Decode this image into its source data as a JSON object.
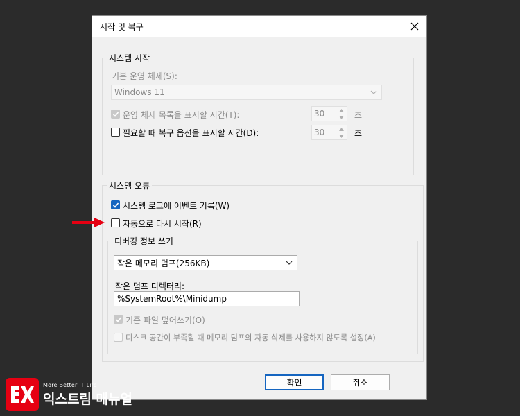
{
  "dialog": {
    "title": "시작 및 복구",
    "close_icon": "close-icon"
  },
  "system_startup": {
    "legend": "시스템 시작",
    "default_os_label": "기본 운영 체제(S):",
    "default_os_value": "Windows 11",
    "os_list_time_label": "운영 체제 목록을 표시할 시간(T):",
    "os_list_time_value": "30",
    "os_list_time_unit": "초",
    "recovery_time_label": "필요할 때 복구 옵션을 표시할 시간(D):",
    "recovery_time_value": "30",
    "recovery_time_unit": "초"
  },
  "system_failure": {
    "legend": "시스템 오류",
    "write_event_label": "시스템 로그에 이벤트 기록(W)",
    "auto_restart_label": "자동으로 다시 시작(R)",
    "debug_info": {
      "legend": "디버깅 정보 쓰기",
      "dump_type": "작은 메모리 덤프(256KB)",
      "dump_dir_label": "작은 덤프 디렉터리:",
      "dump_dir_value": "%SystemRoot%\\Minidump",
      "overwrite_label": "기존 파일 덮어쓰기(O)",
      "disable_autodelete_label": "디스크 공간이 부족할 때 메모리 덤프의 자동 삭제를 사용하지 않도록 설정(A)"
    }
  },
  "buttons": {
    "ok": "확인",
    "cancel": "취소"
  },
  "colors": {
    "accent": "#1565c0",
    "annotation_arrow": "#e60012",
    "backdrop": "#2b2b2b"
  },
  "watermark": {
    "tagline": "More Better IT Life",
    "name": "익스트림 매뉴얼"
  }
}
